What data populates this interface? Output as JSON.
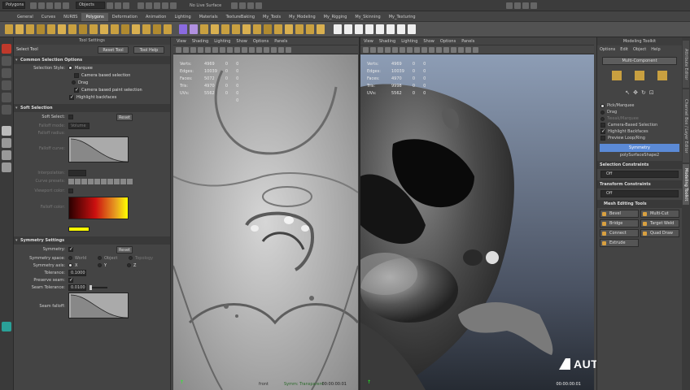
{
  "topbar": {
    "mode_menu": "Polygons",
    "selection_mask": "Objects",
    "live_surface": "No Live Surface"
  },
  "shelf_tabs": [
    {
      "label": "General",
      "active": false
    },
    {
      "label": "Curves",
      "active": false
    },
    {
      "label": "NURBS",
      "active": false
    },
    {
      "label": "Polygons",
      "active": true
    },
    {
      "label": "Deformation",
      "active": false
    },
    {
      "label": "Animation",
      "active": false
    },
    {
      "label": "Lighting",
      "active": false
    },
    {
      "label": "Materials",
      "active": false
    },
    {
      "label": "TextureBaking",
      "active": false
    },
    {
      "label": "My_Tools",
      "active": false
    },
    {
      "label": "My_Modeling",
      "active": false
    },
    {
      "label": "My_Rigging",
      "active": false
    },
    {
      "label": "My_Skinning",
      "active": false
    },
    {
      "label": "My_Texturing",
      "active": false
    }
  ],
  "tool_settings": {
    "panel_title": "Tool Settings",
    "tool_name": "Select Tool",
    "reset_button": "Reset Tool",
    "help_button": "Tool Help",
    "common_header": "Common Selection Options",
    "selection_style_label": "Selection Style:",
    "marquee": "Marquee",
    "camera_based": "Camera based selection",
    "drag": "Drag",
    "camera_paint": "Camera based paint selection",
    "highlight_backfaces": "Highlight backfaces",
    "soft_header": "Soft Selection",
    "soft_select_label": "Soft Select:",
    "reset_label": "Reset",
    "falloff_mode_label": "Falloff mode:",
    "falloff_mode_value": "Volume",
    "falloff_radius_label": "Falloff radius:",
    "falloff_curve_label": "Falloff curve:",
    "interpolation_label": "Interpolation:",
    "curve_presets_label": "Curve presets:",
    "viewport_color_label": "Viewport color:",
    "color_label": "Falloff color:",
    "symmetry_header": "Symmetry Settings",
    "symmetry_label": "Symmetry:",
    "symmetry_reset": "Reset",
    "symmetry_space_label": "Symmetry space:",
    "space_world": "World",
    "space_object": "Object",
    "space_topology": "Topology",
    "symmetry_axis_label": "Symmetry axis:",
    "axis_x": "X",
    "axis_y": "Y",
    "axis_z": "Z",
    "tolerance_label": "Tolerance:",
    "tolerance_value": "0.1000",
    "preserve_seam_label": "Preserve seam:",
    "seam_tolerance_label": "Seam Tolerance:",
    "seam_tolerance_value": "0.0100",
    "seam_falloff_label": "Seam falloff:"
  },
  "viewport_menu": [
    "View",
    "Shading",
    "Lighting",
    "Show",
    "Options",
    "Panels"
  ],
  "left_viewport": {
    "stats": [
      {
        "label": "Verts:",
        "values": [
          "4969",
          "0",
          "0"
        ]
      },
      {
        "label": "Edges:",
        "values": [
          "10039",
          "0",
          "0"
        ]
      },
      {
        "label": "Faces:",
        "values": [
          "5072",
          "0",
          "0"
        ]
      },
      {
        "label": "Tris:",
        "values": [
          "4970",
          "0",
          "0"
        ]
      },
      {
        "label": "UVs:",
        "values": [
          "5562",
          "0",
          "0"
        ]
      },
      {
        "label": "",
        "values": [
          "",
          "",
          "0"
        ]
      }
    ],
    "camera_label": "front",
    "symmetry_status": "Symm: Transparent",
    "timecode": "00:00:00:01"
  },
  "right_viewport": {
    "stats": [
      {
        "label": "Verts:",
        "values": [
          "4969",
          "0",
          "0"
        ]
      },
      {
        "label": "Edges:",
        "values": [
          "10039",
          "0",
          "0"
        ]
      },
      {
        "label": "Faces:",
        "values": [
          "4970",
          "0",
          "0"
        ]
      },
      {
        "label": "Tris:",
        "values": [
          "9998",
          "0",
          "0"
        ]
      },
      {
        "label": "UVs:",
        "values": [
          "5562",
          "0",
          "0"
        ]
      }
    ],
    "timecode": "00:00:00:01"
  },
  "modeling_toolkit": {
    "title": "Modeling Toolkit",
    "menu": [
      "Options",
      "Edit",
      "Object",
      "Help"
    ],
    "multi_component": "Multi-Component",
    "pick_marquee": "Pick/Marquee",
    "drag": "Drag",
    "tweak_marquee": "Tweak/Marquee",
    "camera_based": "Camera-Based Selection",
    "highlight_backfaces": "Highlight Backfaces",
    "preview_loop": "Preview Loop/Ring",
    "symmetry": "Symmetry",
    "symmetry_object": "polySurfaceShape2",
    "selection_constraints": "Selection Constraints",
    "selection_off": "Off",
    "transform_constraints": "Transform Constraints",
    "transform_off": "Off",
    "mesh_editing": "Mesh Editing Tools",
    "tools": [
      "Bevel",
      "Multi-Cut",
      "Bridge",
      "Target Weld",
      "Connect",
      "Quad Draw",
      "Extrude"
    ]
  },
  "side_tabs": [
    "Attribute Editor",
    "Channel Box / Layer Editor",
    "Modeling Toolkit"
  ],
  "watermark": "AUTODESK",
  "colors": {
    "accent_blue": "#5b8ad6",
    "shelf_bg": "#525252",
    "panel_bg": "#444444",
    "falloff_yellow": "#ffff00",
    "falloff_red": "#cc1010"
  }
}
